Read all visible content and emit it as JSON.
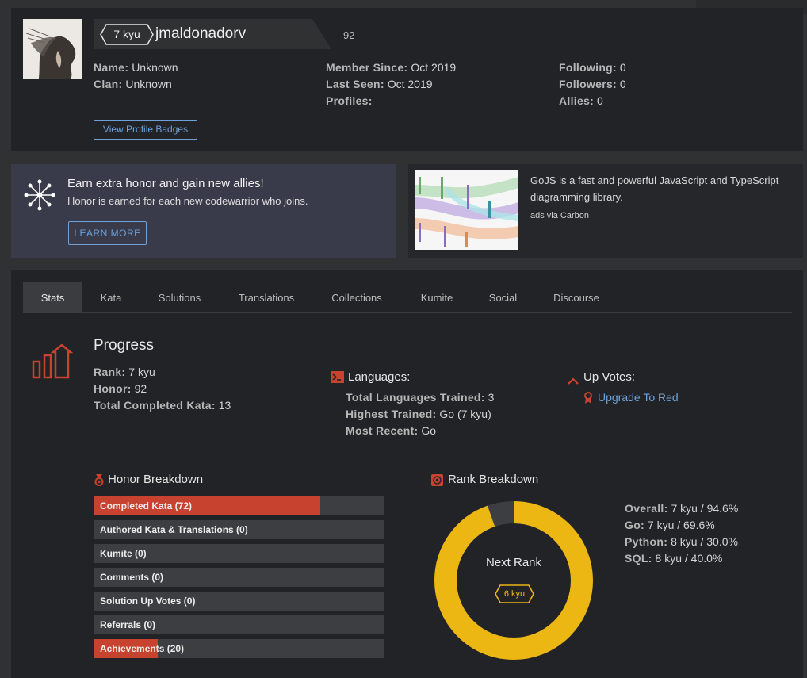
{
  "profile": {
    "rank_label": "7 kyu",
    "username": "jmaldonadorv",
    "honor": "92",
    "col1": [
      {
        "key": "Name:",
        "value": "Unknown"
      },
      {
        "key": "Clan:",
        "value": "Unknown"
      }
    ],
    "col2": [
      {
        "key": "Member Since:",
        "value": "Oct 2019"
      },
      {
        "key": "Last Seen:",
        "value": "Oct 2019"
      },
      {
        "key": "Profiles:",
        "value": ""
      }
    ],
    "col3": [
      {
        "key": "Following:",
        "value": "0"
      },
      {
        "key": "Followers:",
        "value": "0"
      },
      {
        "key": "Allies:",
        "value": "0"
      }
    ],
    "badges_button": "View Profile Badges"
  },
  "invite": {
    "title": "Earn extra honor and gain new allies!",
    "subtitle": "Honor is earned for each new codewarrior who joins.",
    "button": "LEARN MORE"
  },
  "ad": {
    "text": "GoJS is a fast and powerful JavaScript and TypeScript diagramming library.",
    "via": "ads via Carbon"
  },
  "tabs": [
    "Stats",
    "Kata",
    "Solutions",
    "Translations",
    "Collections",
    "Kumite",
    "Social",
    "Discourse"
  ],
  "progress": {
    "title": "Progress",
    "items": [
      {
        "key": "Rank:",
        "value": "7 kyu"
      },
      {
        "key": "Honor:",
        "value": "92"
      },
      {
        "key": "Total Completed Kata:",
        "value": "13"
      }
    ]
  },
  "languages": {
    "title": "Languages:",
    "items": [
      {
        "key": "Total Languages Trained:",
        "value": "3"
      },
      {
        "key": "Highest Trained:",
        "value": "Go (7 kyu)"
      },
      {
        "key": "Most Recent:",
        "value": "Go"
      }
    ]
  },
  "upvotes": {
    "title": "Up Votes:",
    "link": "Upgrade To Red"
  },
  "honor_breakdown": {
    "title": "Honor Breakdown",
    "bars": [
      {
        "label": "Completed Kata (72)",
        "fraction": 0.78
      },
      {
        "label": "Authored Kata & Translations (0)",
        "fraction": 0
      },
      {
        "label": "Kumite (0)",
        "fraction": 0
      },
      {
        "label": "Comments (0)",
        "fraction": 0
      },
      {
        "label": "Solution Up Votes (0)",
        "fraction": 0
      },
      {
        "label": "Referrals (0)",
        "fraction": 0
      },
      {
        "label": "Achievements (20)",
        "fraction": 0.22
      }
    ]
  },
  "rank_breakdown": {
    "title": "Rank Breakdown",
    "next_rank_label": "Next Rank",
    "next_rank_badge": "6 kyu",
    "progress_fraction": 0.946,
    "items": [
      {
        "key": "Overall:",
        "value": "7 kyu / 94.6%"
      },
      {
        "key": "Go:",
        "value": "7 kyu / 69.6%"
      },
      {
        "key": "Python:",
        "value": "8 kyu / 30.0%"
      },
      {
        "key": "SQL:",
        "value": "8 kyu / 40.0%"
      }
    ]
  },
  "colors": {
    "accent_red": "#c7432f",
    "rank_yellow": "#ecb613",
    "link_blue": "#6ea1d8"
  }
}
